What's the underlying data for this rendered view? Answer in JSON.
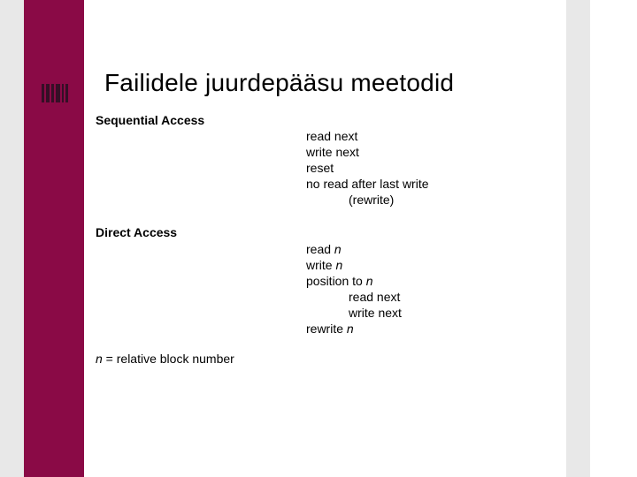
{
  "title": "Failidele juurdepääsu meetodid",
  "section1": {
    "heading": "Sequential Access",
    "items": {
      "l1": "read next",
      "l2": "write next",
      "l3": "reset",
      "l4": "no read after last write",
      "l5_indent": "(rewrite)"
    }
  },
  "section2": {
    "heading": "Direct Access",
    "items": {
      "l1_pre": "read ",
      "l1_var": "n",
      "l2_pre": "write ",
      "l2_var": "n",
      "l3_pre": "position to ",
      "l3_var": "n",
      "l4_indent": "read next",
      "l5_indent": "write next",
      "l6_pre": "rewrite ",
      "l6_var": "n"
    }
  },
  "note": {
    "var": "n",
    "text": " = relative block number"
  }
}
